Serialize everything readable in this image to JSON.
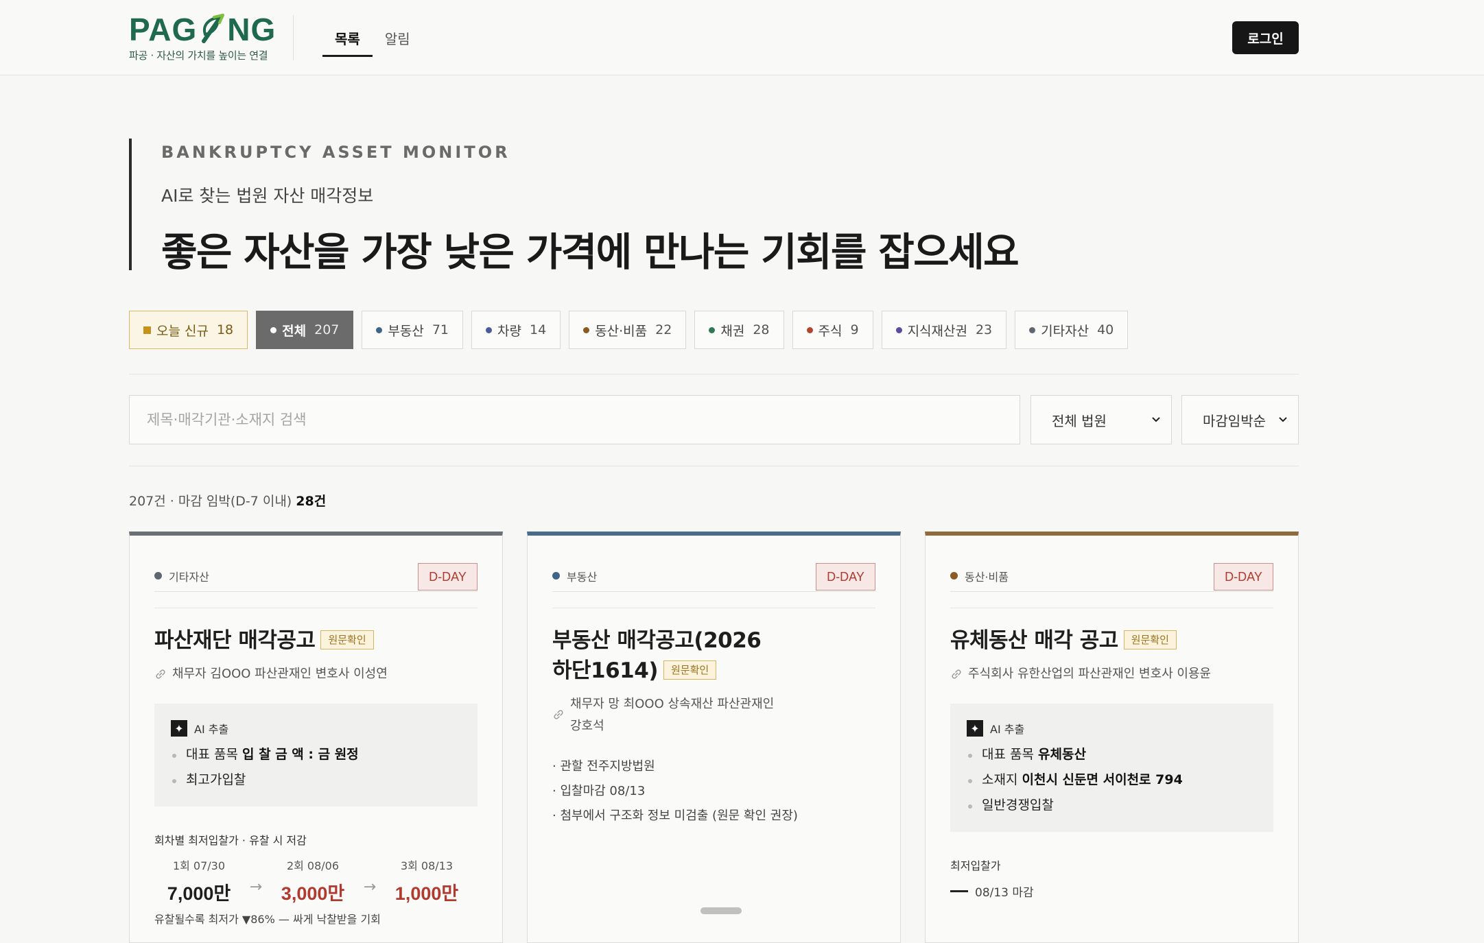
{
  "header": {
    "logo_text_left": "PAG",
    "logo_text_right": "NG",
    "logo_tagline": "파공 · 자산의 가치를 높이는 연결",
    "nav": [
      {
        "label": "목록",
        "active": true
      },
      {
        "label": "알림",
        "active": false
      }
    ],
    "login_label": "로그인"
  },
  "hero": {
    "eyebrow": "BANKRUPTCY ASSET MONITOR",
    "subtitle": "AI로 찾는 법원 자산 매각정보",
    "title": "좋은 자산을 가장 낮은 가격에 만나는 기회를 잡으세요"
  },
  "chips": [
    {
      "label": "오늘 신규",
      "count": "18",
      "kind": "today"
    },
    {
      "label": "전체",
      "count": "207",
      "kind": "selected",
      "color": "#ffffff"
    },
    {
      "label": "부동산",
      "count": "71",
      "color": "#3e6486"
    },
    {
      "label": "차량",
      "count": "14",
      "color": "#4c5a9a"
    },
    {
      "label": "동산·비품",
      "count": "22",
      "color": "#8a5a22"
    },
    {
      "label": "채권",
      "count": "28",
      "color": "#2f7a55"
    },
    {
      "label": "주식",
      "count": "9",
      "color": "#b2472e"
    },
    {
      "label": "지식재산권",
      "count": "23",
      "color": "#5a4aa0"
    },
    {
      "label": "기타자산",
      "count": "40",
      "color": "#5f6670"
    }
  ],
  "search": {
    "placeholder": "제목·매각기관·소재지 검색",
    "court_select": "전체 법원",
    "sort_select": "마감임박순"
  },
  "results": {
    "summary": "207건 · 마감 임박(D-7 이내)",
    "imminent_count": "28건"
  },
  "cards": [
    {
      "category": "기타자산",
      "category_color": "#5f6670",
      "top_color": "#6b7076",
      "dday": "D-DAY",
      "title": "파산재단 매각공고",
      "badge": "원문확인",
      "debtor": "채무자 김OOO 파산관재인 변호사 이성연",
      "ai_label": "AI 추출",
      "ai_items": [
        {
          "key": "대표 품목",
          "value": "입 찰 금 액 : 금 원정"
        },
        {
          "key": "",
          "value": "최고가입찰"
        }
      ],
      "price_label": "회차별 최저입찰가 · 유찰 시 저감",
      "rounds": [
        {
          "date": "1회 07/30",
          "price": "7,000만",
          "color": "#1e1e1e"
        },
        {
          "date": "2회 08/06",
          "price": "3,000만",
          "color": "#b03a2e"
        },
        {
          "date": "3회 08/13",
          "price": "1,000만",
          "color": "#b03a2e"
        }
      ],
      "note": "유찰될수록 최저가 ▼86% — 싸게 낙찰받을 기회"
    },
    {
      "category": "부동산",
      "category_color": "#3e6486",
      "top_color": "#496c8c",
      "dday": "D-DAY",
      "title_line1": "부동산 매각공고(2026",
      "title_line2": "하단1614)",
      "badge": "원문확인",
      "debtor": "채무자 망 최OOO 상속재산 파산관재인 강호석",
      "meta": [
        "· 관할 전주지방법원",
        "· 입찰마감 08/13",
        "· 첨부에서 구조화 정보 미검출 (원문 확인 권장)"
      ]
    },
    {
      "category": "동산·비품",
      "category_color": "#8a5a22",
      "top_color": "#8f6a3a",
      "dday": "D-DAY",
      "title": "유체동산 매각 공고",
      "badge": "원문확인",
      "debtor": "주식회사 유한산업의 파산관재인 변호사 이용윤",
      "ai_label": "AI 추출",
      "ai_items": [
        {
          "key": "대표 품목",
          "value": "유체동산"
        },
        {
          "key": "소재지",
          "value": "이천시 신둔면 서이천로 794"
        },
        {
          "key": "",
          "value": "일반경쟁입찰"
        }
      ],
      "price_label": "최저입찰가",
      "deadline": "08/13 마감"
    }
  ]
}
